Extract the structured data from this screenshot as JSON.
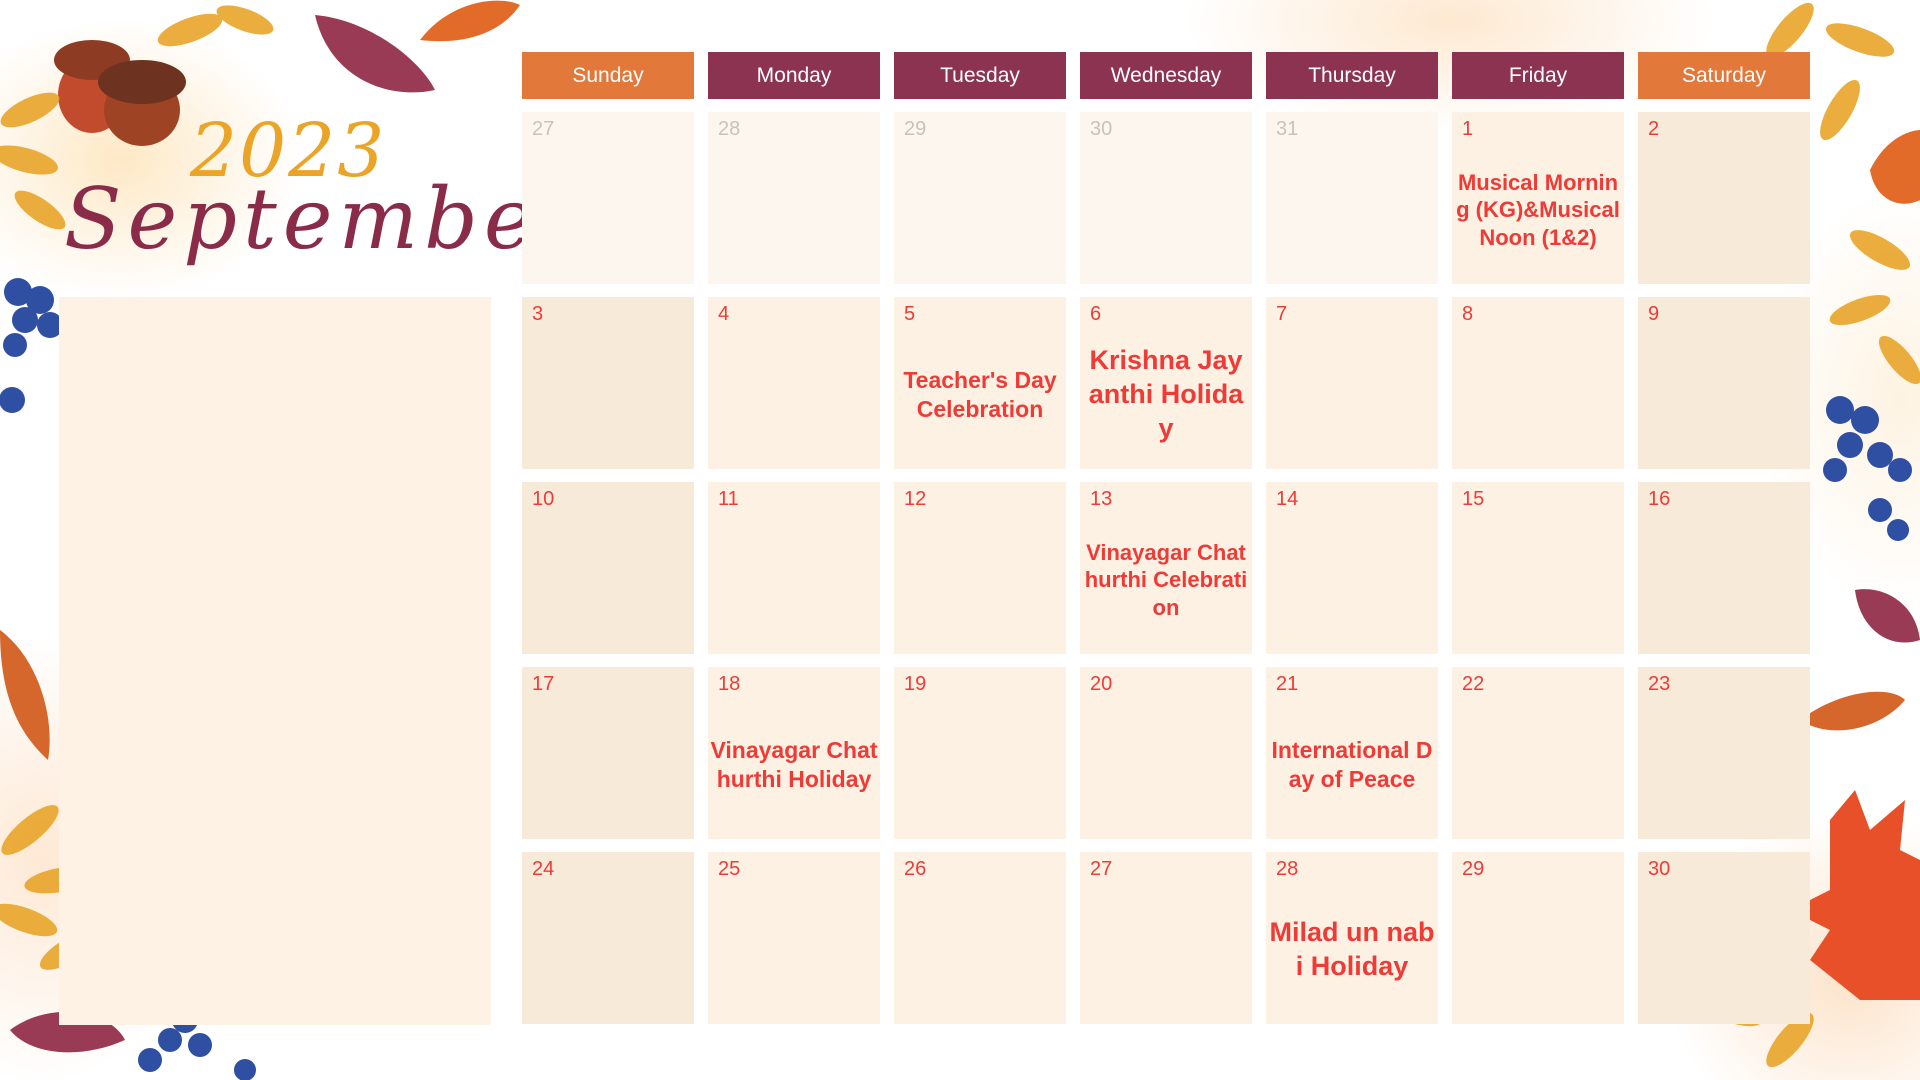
{
  "header": {
    "year": "2023",
    "month": "September"
  },
  "colors": {
    "weekday_header": "#8b3350",
    "weekend_header": "#e2783a",
    "date_text": "#ef3b38",
    "muted_date_text": "#c8c2bb",
    "event_text": "#ef3b38"
  },
  "weekdays": [
    {
      "label": "Sunday",
      "weekend": true
    },
    {
      "label": "Monday",
      "weekend": false
    },
    {
      "label": "Tuesday",
      "weekend": false
    },
    {
      "label": "Wednesday",
      "weekend": false
    },
    {
      "label": "Thursday",
      "weekend": false
    },
    {
      "label": "Friday",
      "weekend": false
    },
    {
      "label": "Saturday",
      "weekend": true
    }
  ],
  "weeks": [
    [
      {
        "date": "27",
        "current_month": false
      },
      {
        "date": "28",
        "current_month": false
      },
      {
        "date": "29",
        "current_month": false
      },
      {
        "date": "30",
        "current_month": false
      },
      {
        "date": "31",
        "current_month": false
      },
      {
        "date": "1",
        "current_month": true,
        "event": "Musical Morning (KG)&Musical Noon (1&2)"
      },
      {
        "date": "2",
        "current_month": true
      }
    ],
    [
      {
        "date": "3",
        "current_month": true
      },
      {
        "date": "4",
        "current_month": true
      },
      {
        "date": "5",
        "current_month": true,
        "event": "Teacher's Day Celebration"
      },
      {
        "date": "6",
        "current_month": true,
        "event": "Krishna Jayanthi Holiday"
      },
      {
        "date": "7",
        "current_month": true
      },
      {
        "date": "8",
        "current_month": true
      },
      {
        "date": "9",
        "current_month": true
      }
    ],
    [
      {
        "date": "10",
        "current_month": true
      },
      {
        "date": "11",
        "current_month": true
      },
      {
        "date": "12",
        "current_month": true
      },
      {
        "date": "13",
        "current_month": true,
        "event": "Vinayagar Chathurthi Celebration"
      },
      {
        "date": "14",
        "current_month": true
      },
      {
        "date": "15",
        "current_month": true
      },
      {
        "date": "16",
        "current_month": true
      }
    ],
    [
      {
        "date": "17",
        "current_month": true
      },
      {
        "date": "18",
        "current_month": true,
        "event": "Vinayagar Chathurthi Holiday"
      },
      {
        "date": "19",
        "current_month": true
      },
      {
        "date": "20",
        "current_month": true
      },
      {
        "date": "21",
        "current_month": true,
        "event": "International Day of Peace"
      },
      {
        "date": "22",
        "current_month": true
      },
      {
        "date": "23",
        "current_month": true
      }
    ],
    [
      {
        "date": "24",
        "current_month": true
      },
      {
        "date": "25",
        "current_month": true
      },
      {
        "date": "26",
        "current_month": true
      },
      {
        "date": "27",
        "current_month": true
      },
      {
        "date": "28",
        "current_month": true,
        "event": "Milad un nabi Holiday"
      },
      {
        "date": "29",
        "current_month": true
      },
      {
        "date": "30",
        "current_month": true
      }
    ]
  ]
}
